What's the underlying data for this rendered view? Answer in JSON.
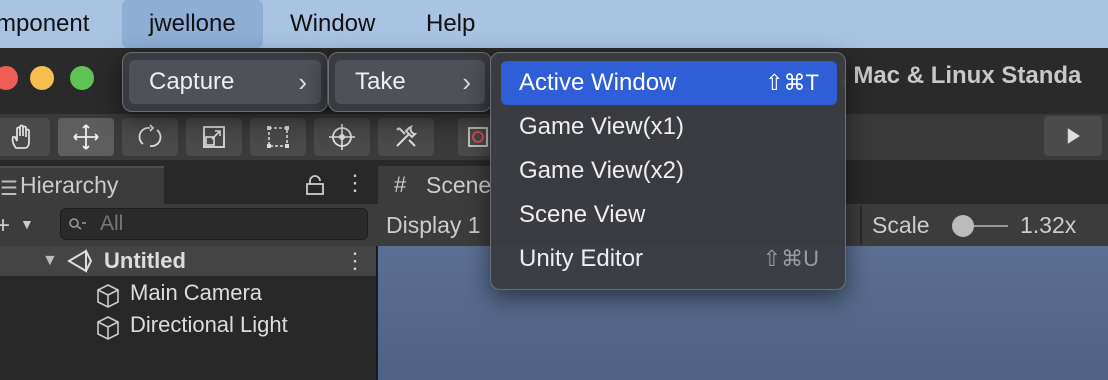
{
  "menubar": {
    "items": [
      "mponent",
      "jwellone",
      "Window",
      "Help"
    ]
  },
  "window": {
    "title": ", Mac & Linux Standa"
  },
  "menus": {
    "capture": {
      "label": "Capture",
      "chevron": "›"
    },
    "take": {
      "label": "Take",
      "chevron": "›"
    },
    "take_submenu": [
      {
        "label": "Active Window",
        "shortcut": "⇧⌘T",
        "highlighted": true
      },
      {
        "label": "Game View(x1)",
        "shortcut": ""
      },
      {
        "label": "Game View(x2)",
        "shortcut": ""
      },
      {
        "label": "Scene View",
        "shortcut": ""
      },
      {
        "label": "Unity Editor",
        "shortcut": "⇧⌘U"
      }
    ]
  },
  "hierarchy": {
    "tab_label": "Hierarchy",
    "search_placeholder": "All",
    "scene_name": "Untitled",
    "objects": [
      "Main Camera",
      "Directional Light"
    ]
  },
  "scene_panel": {
    "tab_label": "Scene",
    "display_label": "Display 1",
    "scale_label": "Scale",
    "scale_value": "1.32x"
  },
  "colors": {
    "menubar": "#a9c3e3",
    "menu_highlight": "#2f5fd6",
    "scene_sky": "#5a6f92"
  }
}
